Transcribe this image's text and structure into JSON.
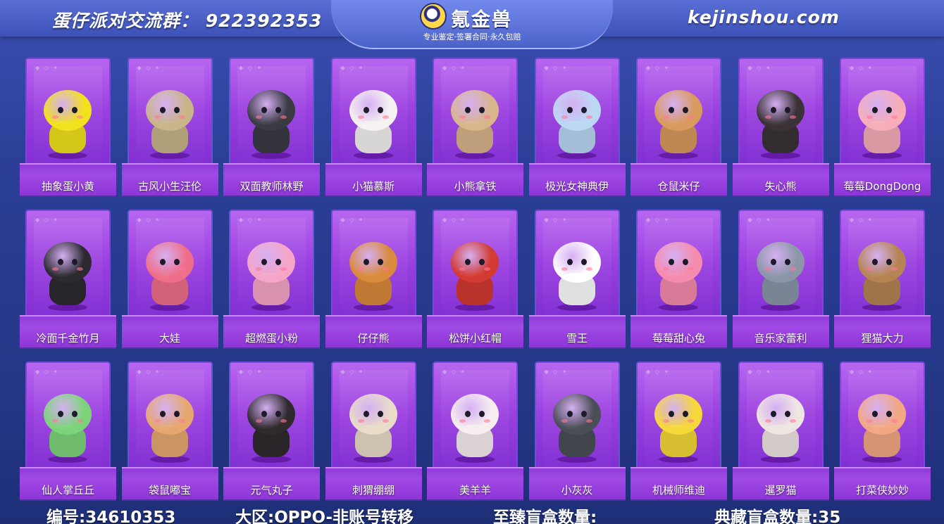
{
  "header": {
    "group_label": "蛋仔派对交流群：  922392353",
    "site_url": "kejinshou.com",
    "logo_text": "氪金兽",
    "slogan": "专业鉴定·签署合同·永久包赔"
  },
  "cards": [
    {
      "name": "抽象蛋小黄",
      "color": "#f2e21c"
    },
    {
      "name": "古风小生汪伦",
      "color": "#c9b58a"
    },
    {
      "name": "双面教师林野",
      "color": "#3a3a44"
    },
    {
      "name": "小猫慕斯",
      "color": "#f6f2f2"
    },
    {
      "name": "小熊拿铁",
      "color": "#d9b58c"
    },
    {
      "name": "极光女神典伊",
      "color": "#bcd8f4"
    },
    {
      "name": "仓鼠米仔",
      "color": "#d99a5e"
    },
    {
      "name": "失心熊",
      "color": "#3a3236"
    },
    {
      "name": "莓莓DongDong",
      "color": "#f7aeb8"
    },
    {
      "name": "冷面千金竹月",
      "color": "#2c2a30"
    },
    {
      "name": "大娃",
      "color": "#ef6f8a"
    },
    {
      "name": "超燃蛋小粉",
      "color": "#f5a6c8"
    },
    {
      "name": "仔仔熊",
      "color": "#d98a3c"
    },
    {
      "name": "松饼小红帽",
      "color": "#d23a32"
    },
    {
      "name": "雪王",
      "color": "#ffffff"
    },
    {
      "name": "莓莓甜心兔",
      "color": "#f58cae"
    },
    {
      "name": "音乐家蕾利",
      "color": "#8c96a8"
    },
    {
      "name": "狸猫大力",
      "color": "#b58452"
    },
    {
      "name": "仙人掌丘丘",
      "color": "#7cd47a"
    },
    {
      "name": "袋鼠嘟宝",
      "color": "#e7a870"
    },
    {
      "name": "元气丸子",
      "color": "#2f2a2e"
    },
    {
      "name": "刺猬绷绷",
      "color": "#e9dcc8"
    },
    {
      "name": "美羊羊",
      "color": "#f7eef0"
    },
    {
      "name": "小灰灰",
      "color": "#4a4e56"
    },
    {
      "name": "机械师维迪",
      "color": "#f6d838"
    },
    {
      "name": "暹罗猫",
      "color": "#efe6e2"
    },
    {
      "name": "打菜侠妙妙",
      "color": "#f3a884"
    }
  ],
  "footer": {
    "id_label": "编号:34610353",
    "region_label": "大区:OPPO-非账号转移",
    "supreme_label": "至臻盲盒数量:",
    "collection_label": "典藏盲盒数量:35"
  }
}
